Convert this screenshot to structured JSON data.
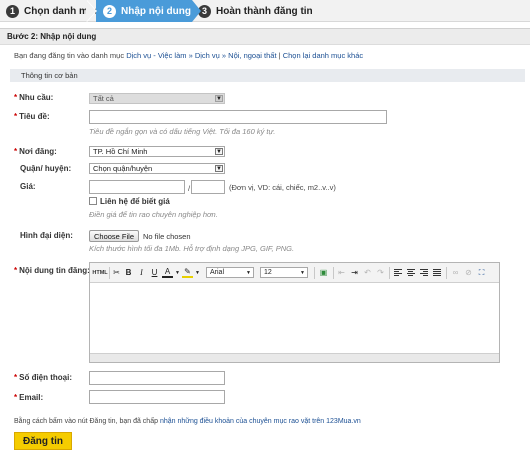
{
  "steps": [
    {
      "num": "1",
      "label": "Chọn danh mục"
    },
    {
      "num": "2",
      "label": "Nhập nội dung"
    },
    {
      "num": "3",
      "label": "Hoàn thành đăng tin"
    }
  ],
  "panel_title": "Bước 2: Nhập nội dung",
  "category": {
    "prefix": "Bạn đang đăng tin vào danh mục",
    "path": "Dịch vụ - Việc làm » Dịch vụ » Nội, ngoại thất",
    "separator": "|",
    "change_link": "Chọn lại danh mục khác"
  },
  "section_title": "Thông tin cơ bản",
  "form": {
    "need": {
      "label": "Nhu cầu:",
      "value": "Tất cả"
    },
    "title": {
      "label": "Tiêu đề:",
      "value": "",
      "hint": "Tiêu đề ngắn gọn và có dấu tiếng Việt. Tối đa 160 ký tự."
    },
    "place": {
      "label": "Nơi đăng:",
      "value": "TP. Hồ Chí Minh"
    },
    "district": {
      "label": "Quận/ huyện:",
      "value": "Chọn quận/huyện"
    },
    "price": {
      "label": "Giá:",
      "separator": "/",
      "unit_hint": "(Đơn vị, VD: cái, chiếc, m2..v..v)",
      "contact_label": "Liên hệ để biết giá",
      "contact_checked": false,
      "hint": "Điền giá để tin rao chuyên nghiệp hơn."
    },
    "avatar": {
      "label": "Hình đại diện:",
      "button": "Choose File",
      "status": "No file chosen",
      "hint": "Kích thước hình tối đa 1Mb. Hỗ trợ định dạng JPG, GIF, PNG."
    },
    "content": {
      "label": "Nội dung tin đăng:"
    },
    "phone": {
      "label": "Số điện thoại:",
      "value": ""
    },
    "email": {
      "label": "Email:",
      "value": ""
    }
  },
  "editor": {
    "html_btn": "HTML",
    "font": "Arial",
    "size": "12",
    "text_color_glyph": "A",
    "bold": "B",
    "italic": "I",
    "underline": "U"
  },
  "terms": {
    "prefix": "Bằng cách bấm vào nút Đăng tin, bạn đã chấp",
    "link": "nhận những điều khoản của chuyên mục rao vặt trên 123Mua.vn"
  },
  "submit_label": "Đăng tin",
  "colors": {
    "active_step": "#4a9bd9",
    "submit": "#f5cc00",
    "required": "#cc0000",
    "link": "#1b4f93"
  }
}
